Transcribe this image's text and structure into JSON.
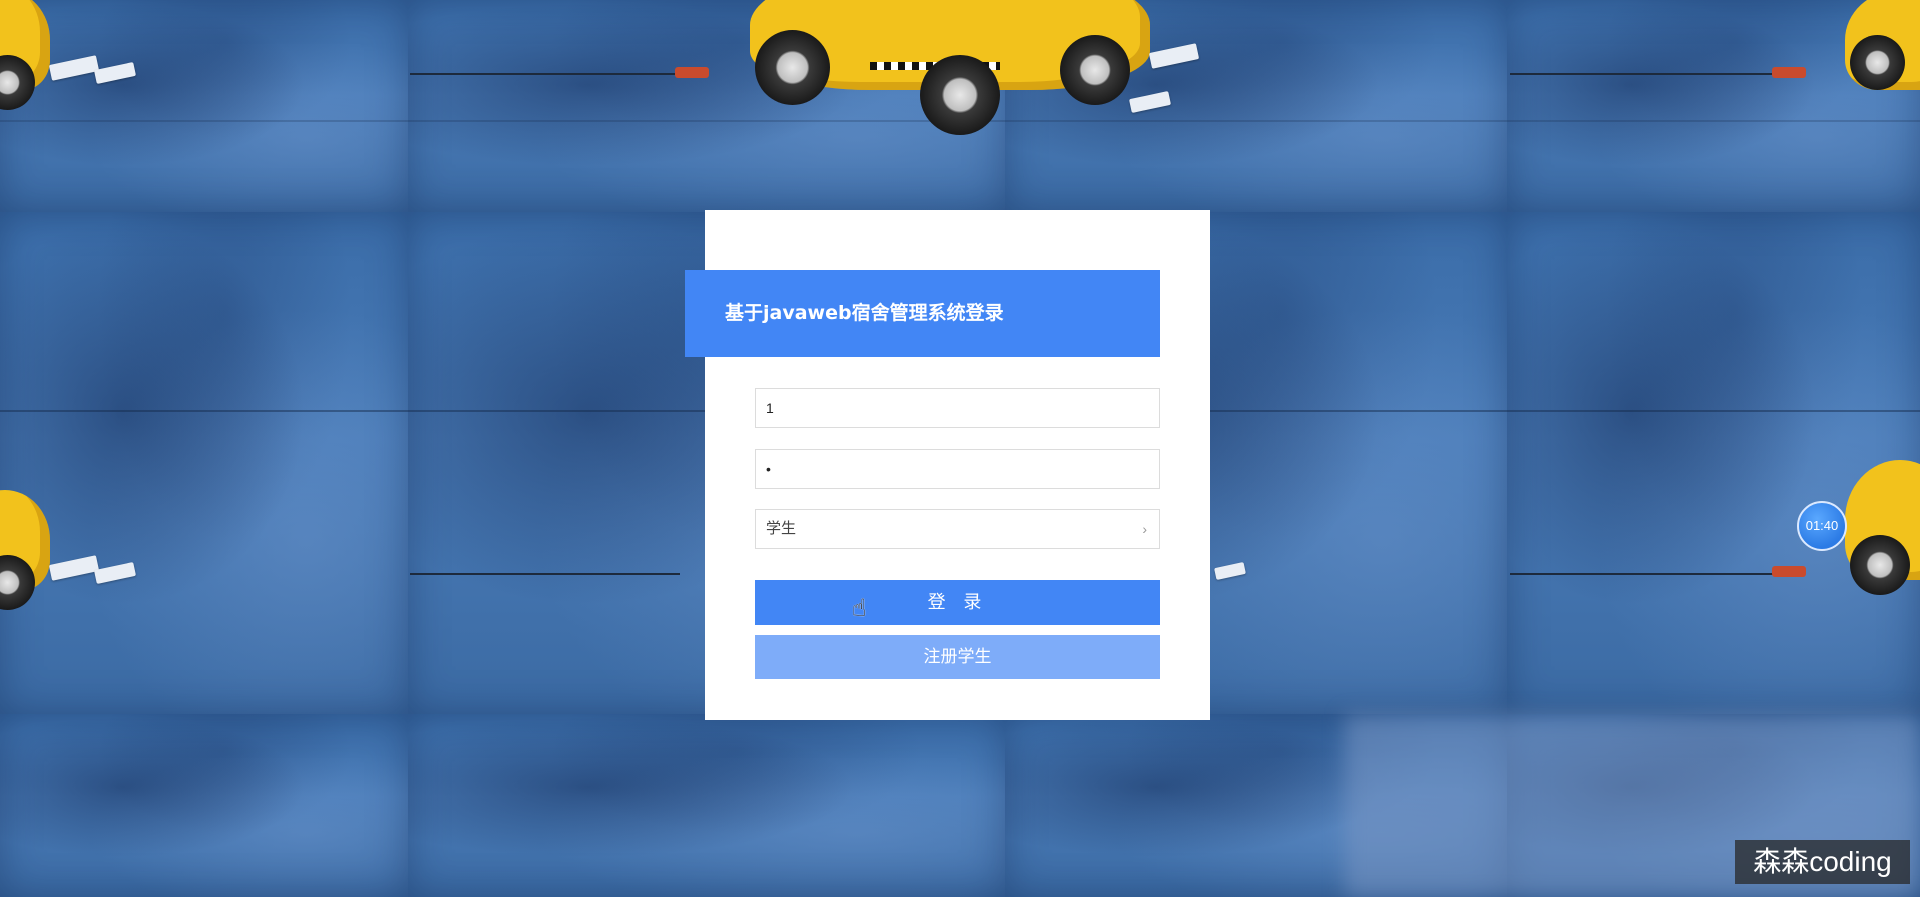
{
  "login": {
    "title": "基于javaweb宿舍管理系统登录",
    "username_value": "1",
    "password_value": "•",
    "role_selected": "学生",
    "login_button": "登 录",
    "register_button": "注册学生"
  },
  "overlay": {
    "timer": "01:40",
    "watermark": "森森coding"
  },
  "colors": {
    "primary": "#4286f5",
    "primary_light": "#7eacf9",
    "background": "#3a6ca8"
  }
}
